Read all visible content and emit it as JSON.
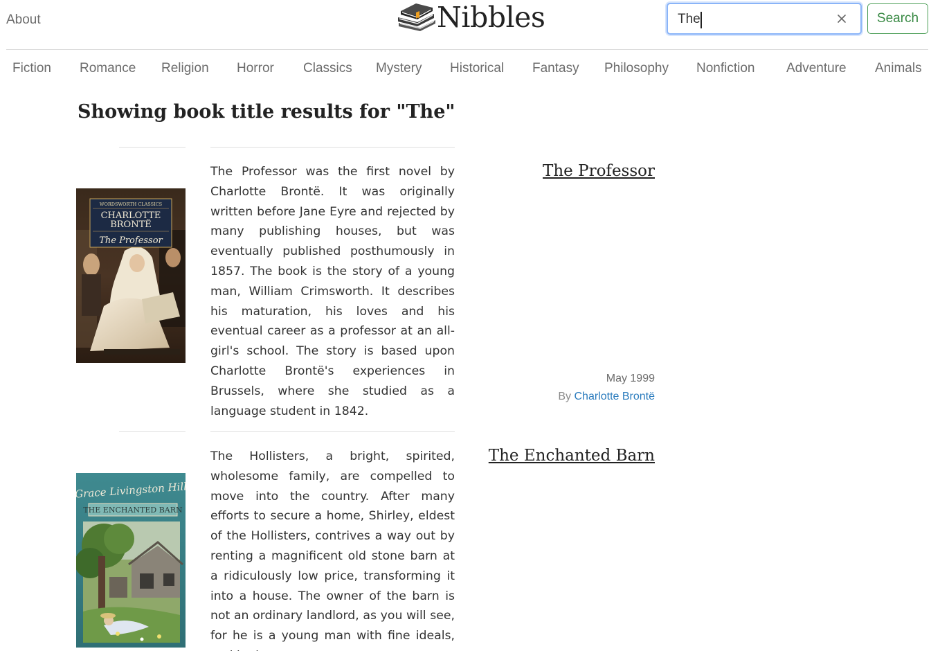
{
  "header": {
    "about_label": "About",
    "brand_name": "Nibbles",
    "search_value": "The",
    "search_button_label": "Search"
  },
  "categories": [
    "Fiction",
    "Romance",
    "Religion",
    "Horror",
    "Classics",
    "Mystery",
    "Historical",
    "Fantasy",
    "Philosophy",
    "Nonfiction",
    "Adventure",
    "Animals"
  ],
  "results": {
    "heading_prefix": "Showing book title results for \"",
    "query": "The",
    "heading_suffix": "\"",
    "books": [
      {
        "title": "The Professor",
        "date": "May 1999",
        "author_prefix": "By ",
        "author": "Charlotte Brontë",
        "cover_series": "WORDSWORTH CLASSICS",
        "cover_author_line1": "CHARLOTTE",
        "cover_author_line2": "BRONTË",
        "cover_title": "The Professor",
        "description": "The Professor was the first novel by Charlotte Brontë. It was originally written before Jane Eyre and rejected by many publishing houses, but was eventually published posthumously in 1857. The book is the story of a young man, William Crimsworth. It describes his maturation, his loves and his eventual career as a professor at an all-girl's school. The story is based upon Charlotte Brontë's experiences in Brussels, where she studied as a language student in 1842."
      },
      {
        "title": "The Enchanted Barn",
        "cover_author": "Grace Livingston Hill",
        "cover_title": "THE ENCHANTED BARN",
        "description": "The Hollisters, a bright, spirited, wholesome family, are compelled to move into the country. After many efforts to secure a home, Shirley, eldest of the Hollisters, contrives a way out by renting a magnificent old stone barn at a ridiculously low price, transforming it into a house. The owner of the barn is not an ordinary landlord, as you will see, for he is a young man with fine ideals, and he is"
      }
    ]
  }
}
